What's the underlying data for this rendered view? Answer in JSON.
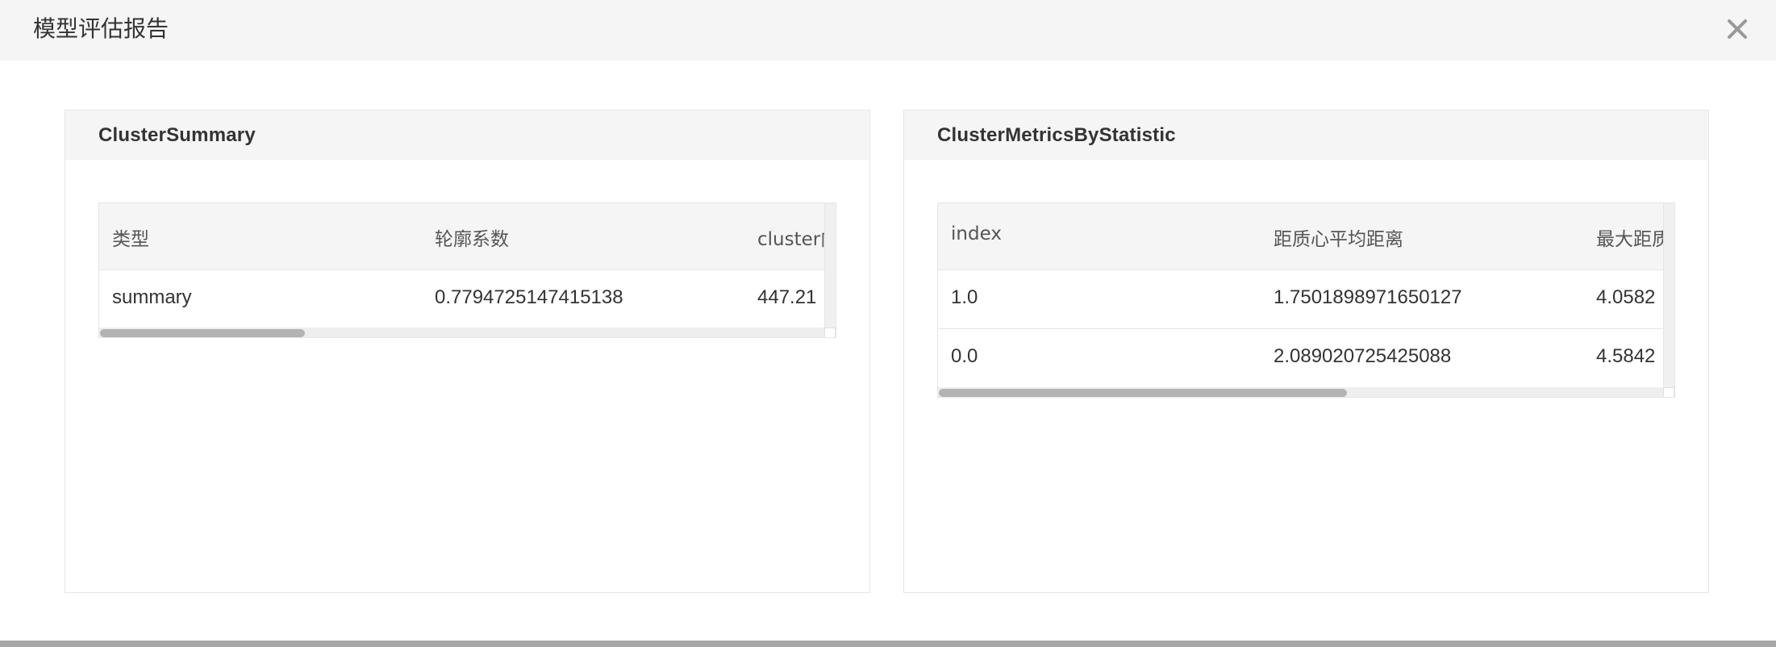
{
  "modal": {
    "title": "模型评估报告",
    "close_icon": "close-icon"
  },
  "panels": [
    {
      "title": "ClusterSummary",
      "columns": [
        "类型",
        "轮廓系数",
        "cluster内"
      ],
      "rows": [
        [
          "summary",
          "0.7794725147415138",
          "447.21"
        ]
      ]
    },
    {
      "title": "ClusterMetricsByStatistic",
      "columns": [
        "index",
        "距质心平均距离",
        "最大距质"
      ],
      "rows": [
        [
          "1.0",
          "1.7501898971650127",
          "4.0582"
        ],
        [
          "0.0",
          "2.089020725425088",
          "4.5842"
        ]
      ]
    }
  ]
}
